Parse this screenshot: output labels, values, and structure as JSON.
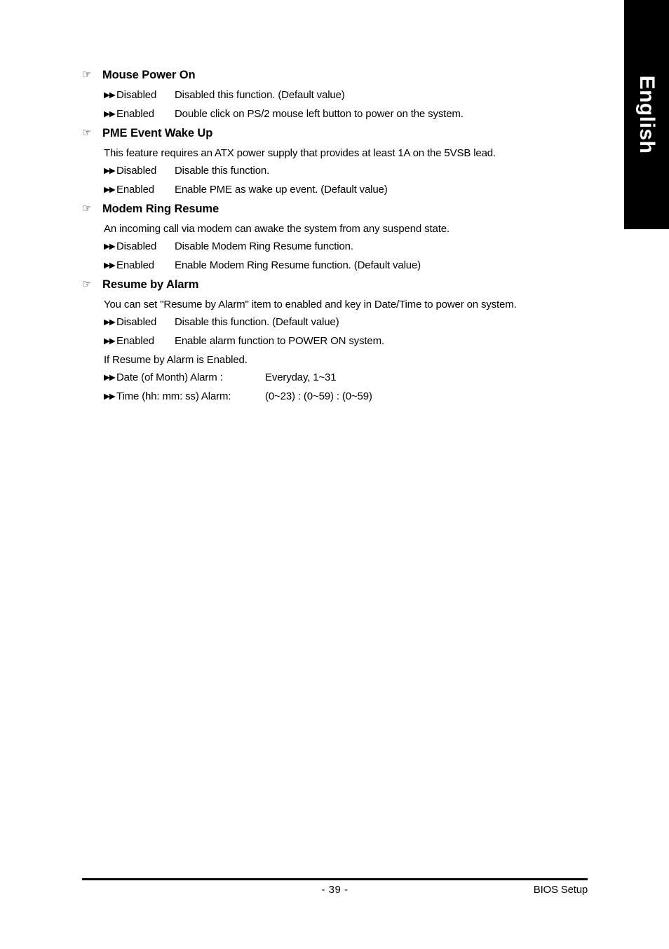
{
  "language_tab": {
    "label": "English"
  },
  "icons": {
    "section_bullet": "☞",
    "option_bullet": "▶▶"
  },
  "sections": [
    {
      "title": "Mouse Power On",
      "note": null,
      "options": [
        {
          "label": "Disabled",
          "desc": "Disabled this function. (Default value)"
        },
        {
          "label": "Enabled",
          "desc": "Double click on PS/2 mouse left button to power on the system."
        }
      ]
    },
    {
      "title": "PME Event Wake Up",
      "note": "This feature requires an ATX power supply that provides at least 1A on the 5VSB lead.",
      "options": [
        {
          "label": "Disabled",
          "desc": "Disable this function."
        },
        {
          "label": "Enabled",
          "desc": "Enable PME as wake up event. (Default value)"
        }
      ]
    },
    {
      "title": "Modem Ring Resume",
      "note": "An incoming call via modem can awake the system from any suspend state.",
      "options": [
        {
          "label": "Disabled",
          "desc": "Disable Modem Ring Resume function."
        },
        {
          "label": "Enabled",
          "desc": "Enable Modem Ring Resume function. (Default value)"
        }
      ]
    },
    {
      "title": "Resume by Alarm",
      "note": "You can set \"Resume by Alarm\" item to enabled and key in Date/Time to power on system.",
      "options": [
        {
          "label": "Disabled",
          "desc": "Disable this function. (Default value)"
        },
        {
          "label": "Enabled",
          "desc": "Enable alarm function to POWER ON system."
        }
      ],
      "note2": "If Resume by Alarm is Enabled.",
      "options2": [
        {
          "label": "Date (of Month) Alarm :",
          "desc": "Everyday, 1~31"
        },
        {
          "label": "Time (hh: mm: ss) Alarm:",
          "desc": "(0~23) : (0~59) : (0~59)"
        }
      ]
    }
  ],
  "footer": {
    "page_number": "- 39 -",
    "right_label": "BIOS Setup"
  }
}
